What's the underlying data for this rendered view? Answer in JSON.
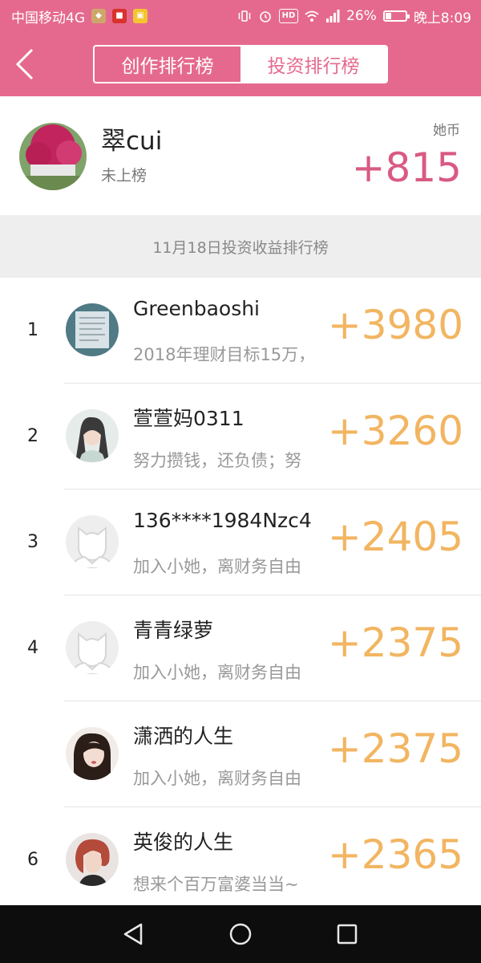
{
  "status_bar": {
    "carrier": "中国移动4G",
    "battery_percent": "26%",
    "battery_level": 0.26,
    "time": "晚上8:09",
    "icons": [
      "vibrate-icon",
      "alarm-icon",
      "hd-icon",
      "wifi-icon",
      "signal-icon",
      "battery-icon"
    ]
  },
  "header": {
    "tabs": [
      {
        "label": "创作排行榜",
        "active": false
      },
      {
        "label": "投资排行榜",
        "active": true
      }
    ]
  },
  "profile": {
    "name": "翠cui",
    "status": "未上榜",
    "coin_label": "她币",
    "score": "+815"
  },
  "section_label": "11月18日投资收益排行榜",
  "rankings": [
    {
      "rank": "1",
      "name": "Greenbaoshi",
      "motto": "2018年理财目标15万，",
      "score": "+3980",
      "avatar": "photo"
    },
    {
      "rank": "2",
      "name": "萱萱妈0311",
      "motto": "努力攒钱，还负债；努",
      "score": "+3260",
      "avatar": "photo"
    },
    {
      "rank": "3",
      "name": "136****1984Nzc4",
      "motto": "加入小她，离财务自由",
      "score": "+2405",
      "avatar": "default"
    },
    {
      "rank": "4",
      "name": "青青绿萝",
      "motto": "加入小她，离财务自由",
      "score": "+2375",
      "avatar": "default"
    },
    {
      "rank": "",
      "name": "潇洒的人生",
      "motto": "加入小她，离财务自由",
      "score": "+2375",
      "avatar": "photo"
    },
    {
      "rank": "6",
      "name": "英俊的人生",
      "motto": "想来个百万富婆当当~",
      "score": "+2365",
      "avatar": "photo"
    }
  ],
  "colors": {
    "brand_pink": "#e5698e",
    "score_pink": "#d95a82",
    "score_orange": "#f2b561"
  }
}
